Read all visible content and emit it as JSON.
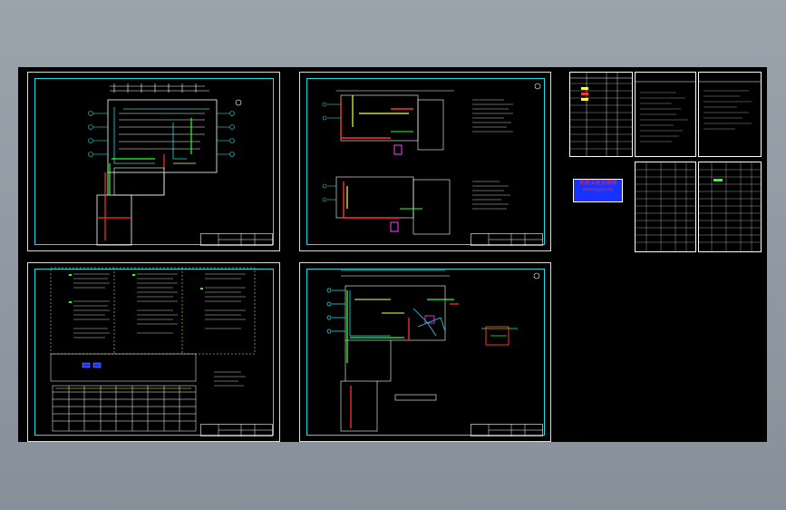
{
  "window": {
    "background": "#8f97a1"
  },
  "drawing": {
    "background": "#000000",
    "frame_color": "#27d9e0",
    "sheets": [
      {
        "id": "sheet-1",
        "kind": "floor-plan"
      },
      {
        "id": "sheet-2",
        "kind": "two-floor-plans"
      },
      {
        "id": "sheet-3",
        "kind": "equipment-schedule"
      },
      {
        "id": "sheet-4",
        "kind": "floor-plan-with-detail"
      }
    ],
    "side_tables": 4,
    "stamp": {
      "line1": "天涯工程资源网",
      "line2": "www.tyggzy.com",
      "bg": "#1a32ff",
      "text_color": "#ff2b2b"
    }
  }
}
